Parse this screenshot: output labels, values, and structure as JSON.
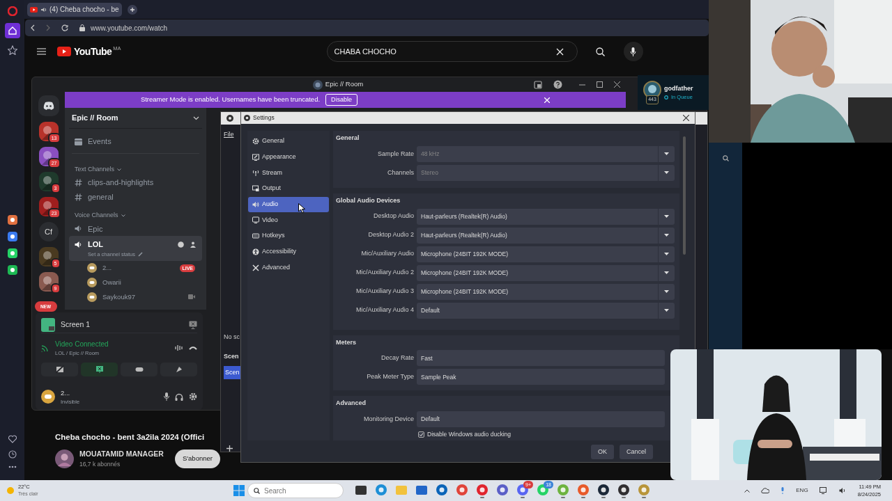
{
  "browser": {
    "tab": {
      "title": "(4) Cheba chocho - be",
      "selected": true
    },
    "url": "www.youtube.com/watch"
  },
  "youtube": {
    "logo": "YouTube",
    "region": "MA",
    "search": "CHABA CHOCHO",
    "video_title": "Cheba chocho - bent 3a2ila 2024 (Offici",
    "channel": "MOUATAMID MANAGER",
    "subscribers": "16,7 k abonnés",
    "subscribe": "S'abonner"
  },
  "discord": {
    "title": "Epic // Room",
    "banner": {
      "text": "Streamer Mode is enabled. Usernames have been truncated.",
      "action": "Disable"
    },
    "servers": [
      {
        "color": "#b8322a",
        "badge": "13"
      },
      {
        "color": "#8a4fc0",
        "badge": "27"
      },
      {
        "color": "#1f3a2c",
        "badge": "3"
      },
      {
        "color": "#a01e1e",
        "badge": "23"
      },
      {
        "kind": "text",
        "label": "Cf"
      },
      {
        "color": "#4a3a20",
        "badge": "5"
      },
      {
        "color": "#8a5a50",
        "badge": "9"
      },
      {
        "kind": "new",
        "label": "NEW"
      }
    ],
    "server_name": "Epic // Room",
    "events": "Events",
    "categories": [
      {
        "label": "Text Channels",
        "channels": [
          {
            "kind": "text",
            "name": "clips-and-highlights",
            "selected": false
          },
          {
            "kind": "text",
            "name": "general",
            "selected": false
          }
        ]
      },
      {
        "label": "Voice Channels",
        "channels": [
          {
            "kind": "voice",
            "name": "Epic",
            "selected": false
          },
          {
            "kind": "voice",
            "name": "LOL",
            "selected": true,
            "status": "Set a channel status",
            "members": [
              {
                "name": "2...",
                "badge": "LIVE",
                "video": false
              },
              {
                "name": "Owarii",
                "video": false
              },
              {
                "name": "Saykouk97",
                "video": true
              }
            ]
          }
        ]
      }
    ],
    "stream": {
      "name": "Screen 1"
    },
    "connection": {
      "status": "Video Connected",
      "location": "LOL / Epic // Room"
    },
    "user": {
      "name": "2...",
      "status": "Invisible"
    }
  },
  "obs_main": {
    "menu": [
      "File"
    ],
    "sources_empty": "No sc",
    "scenes_header": "Scen",
    "scenes": [
      {
        "name": "Scen",
        "selected": true
      }
    ]
  },
  "settings": {
    "title": "Settings",
    "nav": [
      {
        "label": "General",
        "kind": "gear",
        "selected": false
      },
      {
        "label": "Appearance",
        "kind": "frame",
        "selected": false
      },
      {
        "label": "Stream",
        "kind": "antenna",
        "selected": false
      },
      {
        "label": "Output",
        "kind": "output",
        "selected": false
      },
      {
        "label": "Audio",
        "kind": "speaker",
        "selected": true
      },
      {
        "label": "Video",
        "kind": "monitor",
        "selected": false
      },
      {
        "label": "Hotkeys",
        "kind": "keyboard",
        "selected": false
      },
      {
        "label": "Accessibility",
        "kind": "person",
        "selected": false
      },
      {
        "label": "Advanced",
        "kind": "tools",
        "selected": false
      }
    ],
    "sections": [
      {
        "title": "General",
        "fields": [
          {
            "kind": "select",
            "label": "Sample Rate",
            "value": "48 kHz",
            "disabled": true
          },
          {
            "kind": "select",
            "label": "Channels",
            "value": "Stereo",
            "disabled": true
          }
        ]
      },
      {
        "title": "Global Audio Devices",
        "fields": [
          {
            "kind": "select",
            "label": "Desktop Audio",
            "value": "Haut-parleurs (Realtek(R) Audio)",
            "disabled": false
          },
          {
            "kind": "select",
            "label": "Desktop Audio 2",
            "value": "Haut-parleurs (Realtek(R) Audio)",
            "disabled": false
          },
          {
            "kind": "select",
            "label": "Mic/Auxiliary Audio",
            "value": "Microphone (24BIT 192K MODE)",
            "disabled": false
          },
          {
            "kind": "select",
            "label": "Mic/Auxiliary Audio 2",
            "value": "Microphone (24BIT 192K MODE)",
            "disabled": false
          },
          {
            "kind": "select",
            "label": "Mic/Auxiliary Audio 3",
            "value": "Microphone (24BIT 192K MODE)",
            "disabled": false
          },
          {
            "kind": "select",
            "label": "Mic/Auxiliary Audio 4",
            "value": "Default",
            "disabled": false
          }
        ]
      },
      {
        "title": "Meters",
        "fields": [
          {
            "kind": "select",
            "label": "Decay Rate",
            "value": "Fast",
            "disabled": false
          },
          {
            "kind": "select",
            "label": "Peak Meter Type",
            "value": "Sample Peak",
            "disabled": false
          }
        ]
      },
      {
        "title": "Advanced",
        "fields": [
          {
            "kind": "select",
            "label": "Monitoring Device",
            "value": "Default",
            "disabled": false
          },
          {
            "kind": "checkbox",
            "label": "Disable Windows audio ducking",
            "checked": true
          }
        ]
      }
    ],
    "buttons": [
      "OK",
      "Cancel"
    ]
  },
  "league": {
    "name": "godfather",
    "status": "In Queue",
    "rank": "443"
  },
  "taskbar": {
    "weather": {
      "temp": "22°C",
      "condition": "Très clair"
    },
    "search": {
      "placeholder": "Search"
    },
    "apps": [
      {
        "kind": "taskview",
        "running": false
      },
      {
        "kind": "edge",
        "running": false
      },
      {
        "kind": "folder",
        "running": false
      },
      {
        "kind": "store",
        "running": false
      },
      {
        "kind": "outlook",
        "running": false
      },
      {
        "kind": "chrome",
        "running": false
      },
      {
        "kind": "opera",
        "running": true
      },
      {
        "kind": "teams",
        "running": false
      },
      {
        "kind": "discord",
        "running": true,
        "badge": "9+"
      },
      {
        "kind": "whatsapp",
        "running": false,
        "badge": "18"
      },
      {
        "kind": "torrent",
        "running": true
      },
      {
        "kind": "ea",
        "running": true
      },
      {
        "kind": "steam",
        "running": true
      },
      {
        "kind": "obs",
        "running": true
      },
      {
        "kind": "league",
        "running": true
      }
    ],
    "language": "ENG",
    "time": "11:49 PM",
    "date": "8/24/2025"
  }
}
